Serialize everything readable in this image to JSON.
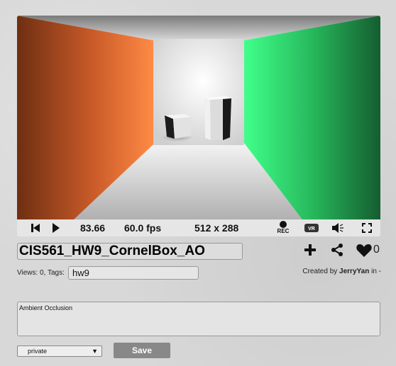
{
  "player": {
    "time": "83.66",
    "fps": "60.0 fps",
    "resolution": "512 x 288",
    "rec_label": "REC",
    "vr_label": "VR"
  },
  "shader": {
    "title": "CIS561_HW9_CornelBox_AO",
    "views_tags_label": "Views: 0, Tags:",
    "tags": "hw9",
    "created_by_prefix": "Created by",
    "author": "JerryYan",
    "created_suffix": "in -",
    "likes": "0",
    "description": "Ambient Occlusion",
    "privacy": "private",
    "save_label": "Save"
  },
  "colors": {
    "left_wall": "#e06a30",
    "right_wall": "#2ecf6e",
    "save_button": "#888888"
  },
  "icons": [
    "rewind-icon",
    "play-icon",
    "record-icon",
    "vr-icon",
    "volume-icon",
    "fullscreen-icon",
    "add-icon",
    "share-icon",
    "heart-icon"
  ]
}
